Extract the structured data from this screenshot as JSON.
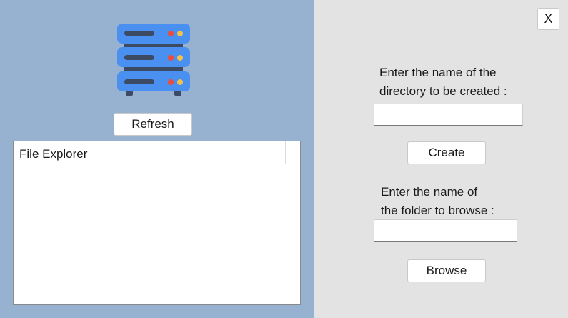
{
  "left": {
    "refresh_label": "Refresh",
    "explorer_header": "File Explorer"
  },
  "right": {
    "close_label": "X",
    "dir_prompt_line1": "Enter the name of the",
    "dir_prompt_line2": "directory to be created :",
    "dir_input_value": "",
    "create_label": "Create",
    "folder_prompt_line1": "Enter the name of",
    "folder_prompt_line2": "the folder to browse :",
    "folder_input_value": "",
    "browse_label": "Browse"
  },
  "icons": [
    "server-icon"
  ],
  "colors": {
    "left_panel_bg": "#97b2d1",
    "right_panel_bg": "#e3e3e3",
    "server_blue": "#4a90f0",
    "server_slot": "#3d4a63",
    "led_red": "#f04a3a",
    "led_yellow": "#f5c04a"
  }
}
